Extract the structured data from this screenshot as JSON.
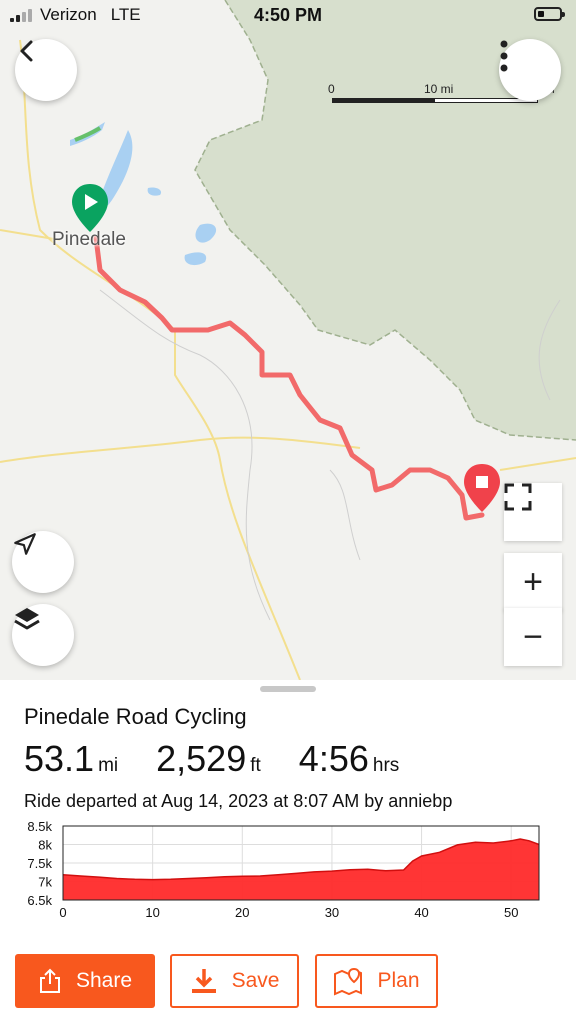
{
  "status_bar": {
    "carrier": "Verizon",
    "network": "LTE",
    "time": "4:50 PM"
  },
  "map": {
    "town_label": "Pinedale",
    "scale": {
      "start": "0",
      "mid": "10 mi",
      "end": "mi"
    },
    "colors": {
      "route": "#f26a6a",
      "start_pin": "#0aa360",
      "end_pin": "#f0424b",
      "forest": "#d7dfcd",
      "water": "#a9d0f2",
      "roads": "#f3df8e"
    }
  },
  "map_controls": {
    "back_icon": "chevron-left-icon",
    "menu_icon": "vertical-ellipsis-icon",
    "fullscreen_icon": "fullscreen-icon",
    "zoom_in": "+",
    "zoom_out": "−",
    "locate_icon": "navigation-arrow-icon",
    "layers_icon": "layers-icon"
  },
  "ride": {
    "title": "Pinedale Road Cycling",
    "distance": {
      "value": "53.1",
      "unit": "mi"
    },
    "elevation": {
      "value": "2,529",
      "unit": "ft"
    },
    "duration": {
      "value": "4:56",
      "unit": "hrs"
    },
    "departed": "Ride departed at Aug 14, 2023 at 8:07 AM by anniebp"
  },
  "chart_data": {
    "type": "area",
    "title": "",
    "xlabel": "",
    "ylabel": "",
    "x_ticks": [
      "0",
      "10",
      "20",
      "30",
      "40",
      "50"
    ],
    "y_ticks": [
      "8.5k",
      "8k",
      "7.5k",
      "7k",
      "6.5k"
    ],
    "xlim": [
      0,
      53.1
    ],
    "ylim": [
      6500,
      8500
    ],
    "grid": true,
    "color": "#ff2a2a",
    "x": [
      0,
      2,
      4,
      6,
      8,
      10,
      12,
      14,
      16,
      18,
      20,
      22,
      24,
      26,
      28,
      30,
      32,
      34,
      36,
      38,
      39,
      40,
      42,
      44,
      46,
      48,
      50,
      51,
      52,
      53.1
    ],
    "y": [
      7180,
      7150,
      7120,
      7080,
      7060,
      7050,
      7060,
      7080,
      7100,
      7130,
      7140,
      7150,
      7180,
      7220,
      7260,
      7280,
      7320,
      7330,
      7290,
      7310,
      7550,
      7690,
      7790,
      7990,
      8060,
      8040,
      8100,
      8150,
      8100,
      8000
    ]
  },
  "actions": {
    "share": {
      "label": "Share",
      "icon": "share-icon"
    },
    "save": {
      "label": "Save",
      "icon": "download-icon"
    },
    "plan": {
      "label": "Plan",
      "icon": "map-pin-icon"
    }
  }
}
